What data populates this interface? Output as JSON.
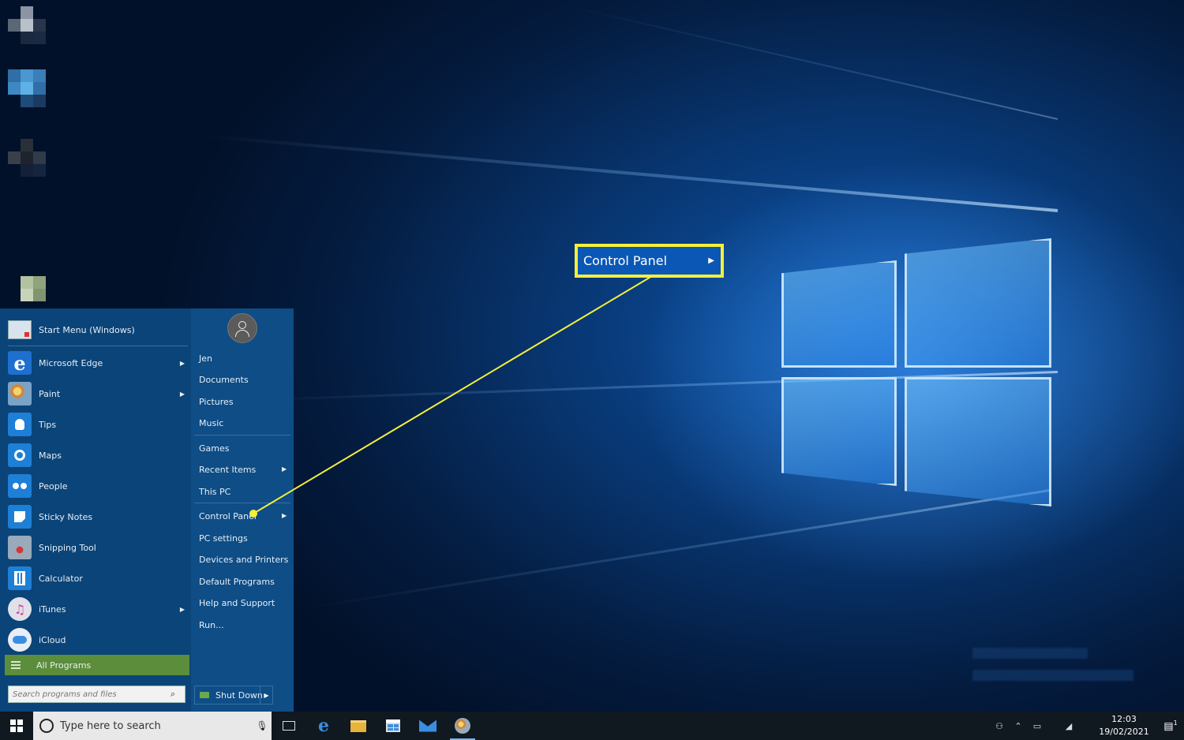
{
  "start_menu": {
    "header": "Start Menu (Windows)",
    "apps": [
      {
        "label": "Microsoft Edge",
        "has_arrow": true,
        "icon": "edge-icon",
        "color": "#1f6fcf"
      },
      {
        "label": "Paint",
        "has_arrow": true,
        "icon": "paint-icon",
        "color": "#8ab0c8"
      },
      {
        "label": "Tips",
        "has_arrow": false,
        "icon": "lightbulb-icon",
        "color": "#1e7fd6"
      },
      {
        "label": "Maps",
        "has_arrow": false,
        "icon": "maps-icon",
        "color": "#1e7fd6"
      },
      {
        "label": "People",
        "has_arrow": false,
        "icon": "people-icon",
        "color": "#1e7fd6"
      },
      {
        "label": "Sticky Notes",
        "has_arrow": false,
        "icon": "sticky-notes-icon",
        "color": "#1e7fd6"
      },
      {
        "label": "Snipping Tool",
        "has_arrow": false,
        "icon": "snipping-tool-icon",
        "color": "#6a8aa8"
      },
      {
        "label": "Calculator",
        "has_arrow": false,
        "icon": "calculator-icon",
        "color": "#1e7fd6"
      },
      {
        "label": "iTunes",
        "has_arrow": true,
        "icon": "itunes-icon",
        "color": "#e0e0ea"
      },
      {
        "label": "iCloud",
        "has_arrow": false,
        "icon": "icloud-icon",
        "color": "#e8eef4"
      }
    ],
    "all_programs": "All Programs",
    "search_placeholder": "Search programs and files",
    "right_items": {
      "user": "Jen",
      "documents": "Documents",
      "pictures": "Pictures",
      "music": "Music",
      "games": "Games",
      "recent_items": "Recent Items",
      "this_pc": "This PC",
      "control_panel": "Control Panel",
      "pc_settings": "PC settings",
      "devices_printers": "Devices and Printers",
      "default_programs": "Default Programs",
      "help_support": "Help and Support",
      "run": "Run..."
    },
    "shut_down": "Shut Down"
  },
  "callout": {
    "label": "Control Panel",
    "border_color": "#f5ef3a"
  },
  "taskbar": {
    "search_placeholder": "Type here to search",
    "time": "12:03",
    "date": "19/02/2021",
    "notification_count": "1"
  },
  "colors": {
    "start_bg": "#0b4478",
    "all_programs_bg": "#5c8d3a",
    "taskbar_bg": "#101820"
  }
}
